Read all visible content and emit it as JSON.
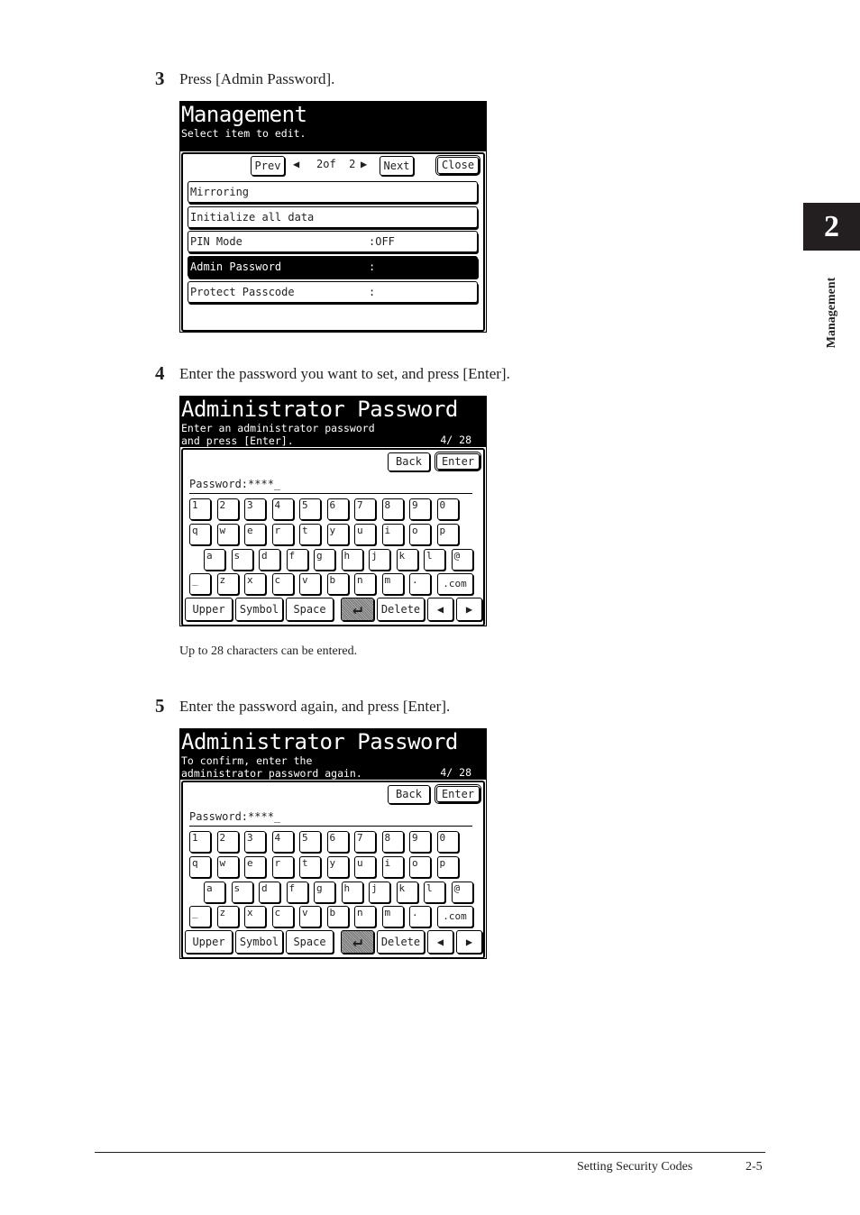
{
  "side_tab": {
    "chapter": "2",
    "label": "Management"
  },
  "steps": [
    {
      "number": "3",
      "text": "Press [Admin Password]."
    },
    {
      "number": "4",
      "text": "Enter the password you want to set, and press [Enter]."
    },
    {
      "number": "5",
      "text": "Enter the password again, and press [Enter]."
    }
  ],
  "screen1": {
    "title": "Management",
    "subtitle": "Select item to edit.",
    "prev": "Prev",
    "page_indicator": "2of  2",
    "next": "Next",
    "close": "Close",
    "items": [
      {
        "label": "Mirroring",
        "value": ""
      },
      {
        "label": "Initialize all data",
        "value": ""
      },
      {
        "label": "PIN Mode",
        "value": ":OFF"
      },
      {
        "label": "Admin Password",
        "value": ":"
      },
      {
        "label": "Protect Passcode",
        "value": ":"
      }
    ]
  },
  "screen2": {
    "title": "Administrator Password",
    "line1": "Enter an administrator password",
    "line2": "and press [Enter].",
    "counter": "4/ 28",
    "back": "Back",
    "enter": "Enter",
    "password_label": "Password:****_"
  },
  "note": "Up to 28 characters can be entered.",
  "screen3": {
    "title": "Administrator Password",
    "line1": "To confirm, enter the",
    "line2": "administrator password again.",
    "counter": "4/ 28",
    "back": "Back",
    "enter": "Enter",
    "password_label": "Password:****_"
  },
  "keyboard": {
    "rows": [
      [
        "1",
        "2",
        "3",
        "4",
        "5",
        "6",
        "7",
        "8",
        "9",
        "0"
      ],
      [
        "q",
        "w",
        "e",
        "r",
        "t",
        "y",
        "u",
        "i",
        "o",
        "p"
      ],
      [
        "a",
        "s",
        "d",
        "f",
        "g",
        "h",
        "j",
        "k",
        "l",
        "@"
      ],
      [
        "_",
        "z",
        "x",
        "c",
        "v",
        "b",
        "n",
        "m",
        ".",
        ".com"
      ]
    ],
    "upper": "Upper",
    "symbol": "Symbol",
    "space": "Space",
    "enter_glyph": "↵",
    "delete": "Delete",
    "left": "◀",
    "right": "▶"
  },
  "footer": {
    "section": "Setting Security Codes",
    "page": "2-5"
  }
}
